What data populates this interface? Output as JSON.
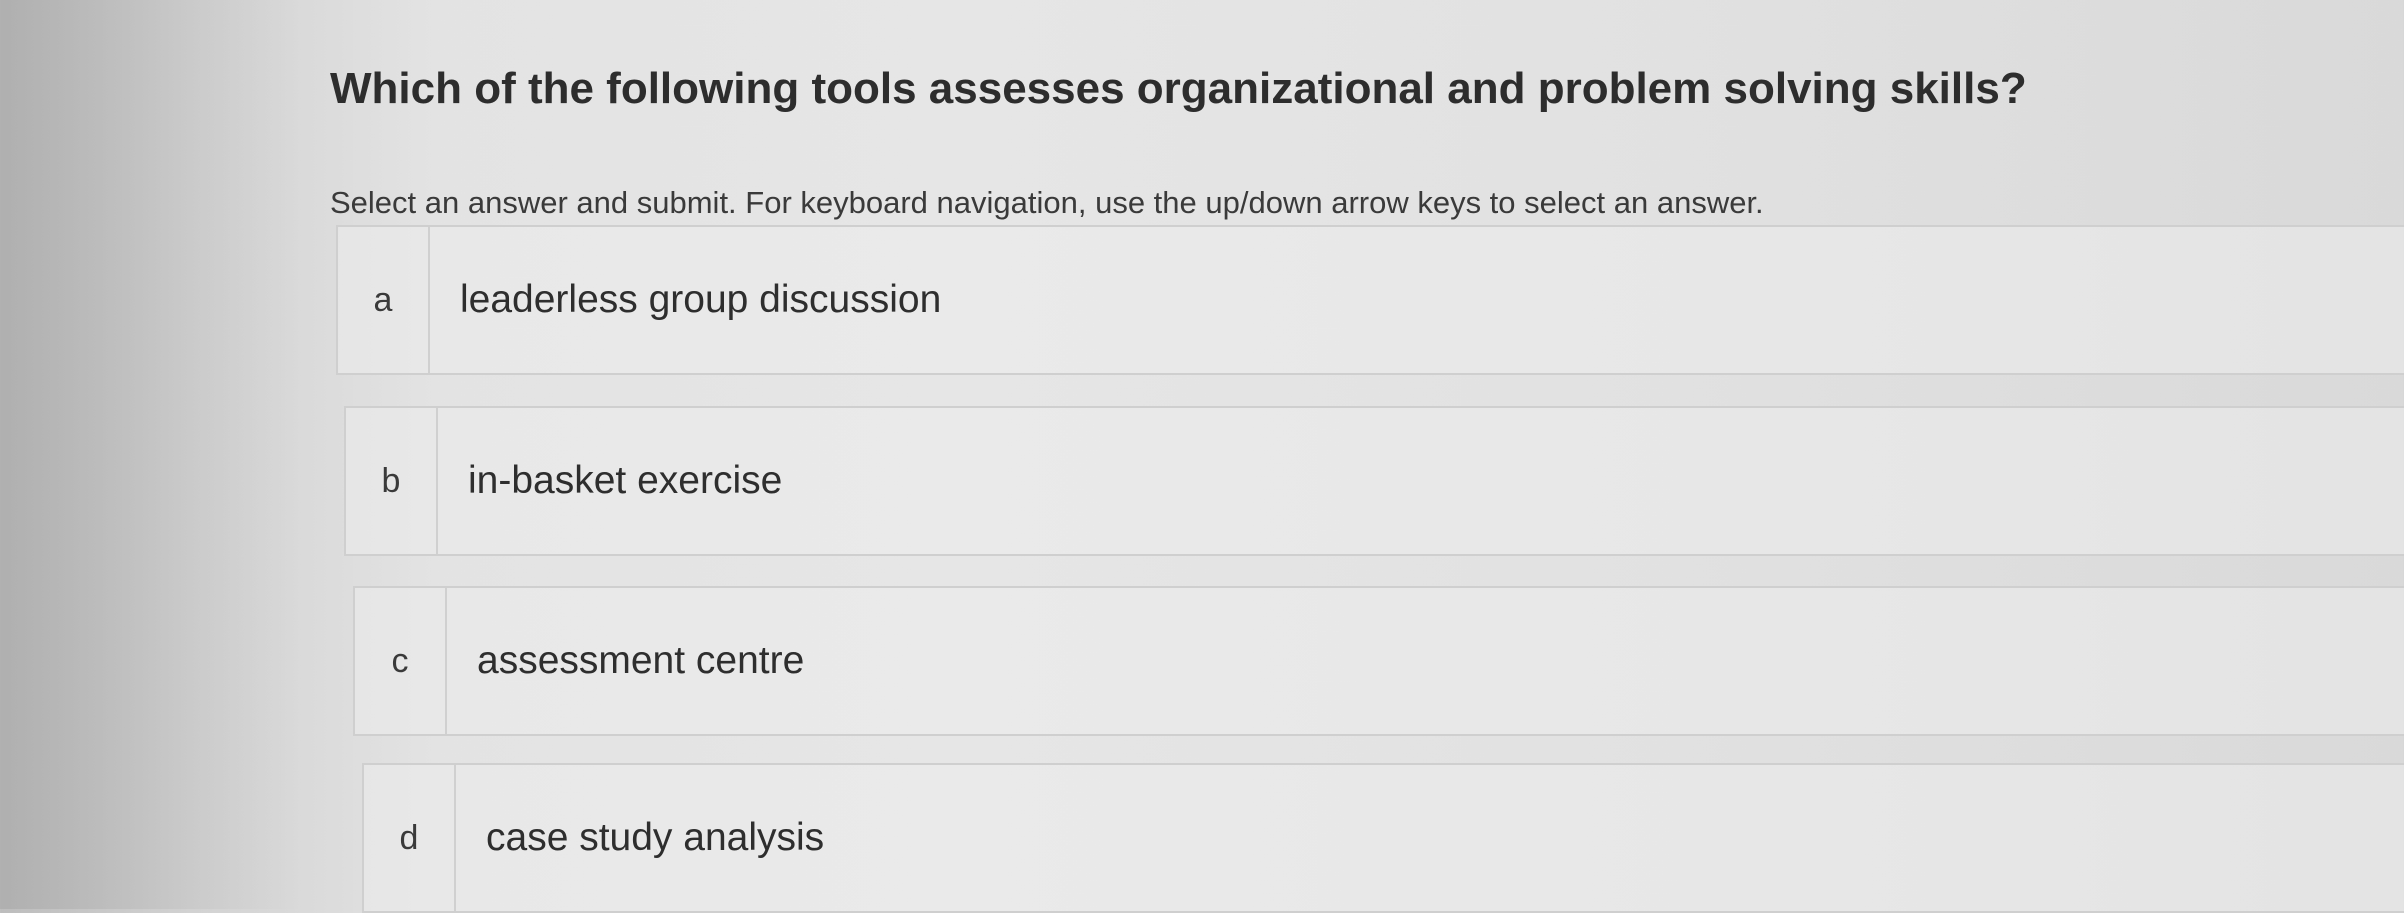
{
  "question": {
    "title": "Which of the following tools assesses organizational and problem solving skills?",
    "instructions": "Select an answer and submit. For keyboard navigation, use the up/down arrow keys to select an answer."
  },
  "options": [
    {
      "letter": "a",
      "text": "leaderless group discussion"
    },
    {
      "letter": "b",
      "text": "in-basket exercise"
    },
    {
      "letter": "c",
      "text": "assessment centre"
    },
    {
      "letter": "d",
      "text": "case study analysis"
    }
  ]
}
